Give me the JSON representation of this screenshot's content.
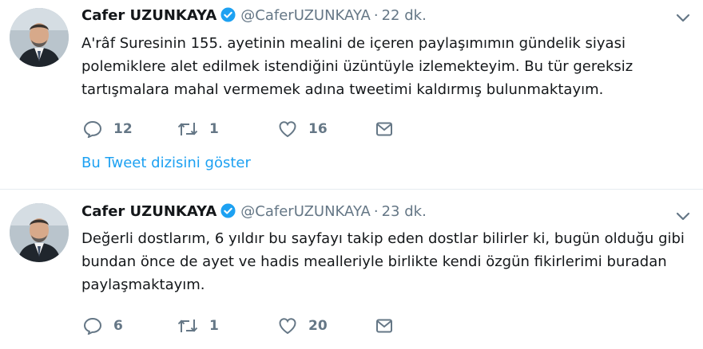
{
  "tweets": [
    {
      "name": "Cafer UZUNKAYA",
      "handle": "@CaferUZUNKAYA",
      "separator": "·",
      "time": "22 dk.",
      "text": "A'râf Suresinin 155. ayetinin mealini de içeren paylaşımımın gündelik siyasi\npolemiklere alet edilmek istendiğini üzüntüyle izlemekteyim. Bu tür gereksiz\ntartışmalara mahal vermemek  adına tweetimi kaldırmış bulunmaktayım.",
      "replies": "12",
      "retweets": "1",
      "likes": "16",
      "thread_link": "Bu Tweet dizisini göster"
    },
    {
      "name": "Cafer UZUNKAYA",
      "handle": "@CaferUZUNKAYA",
      "separator": "·",
      "time": "23 dk.",
      "text": "Değerli dostlarım, 6 yıldır bu sayfayı takip eden dostlar bilirler ki, bugün olduğu gibi\nbundan önce de ayet ve hadis mealleriyle birlikte kendi özgün fikirlerimi buradan\npaylaşmaktayım.",
      "replies": "6",
      "retweets": "1",
      "likes": "20"
    }
  ],
  "colors": {
    "text": "#14171a",
    "muted": "#657786",
    "accent": "#1da1f2",
    "divider": "#e6ecf0"
  },
  "icons": [
    "verified-badge-icon",
    "chevron-down-icon",
    "reply-icon",
    "retweet-icon",
    "like-icon",
    "direct-message-icon"
  ]
}
